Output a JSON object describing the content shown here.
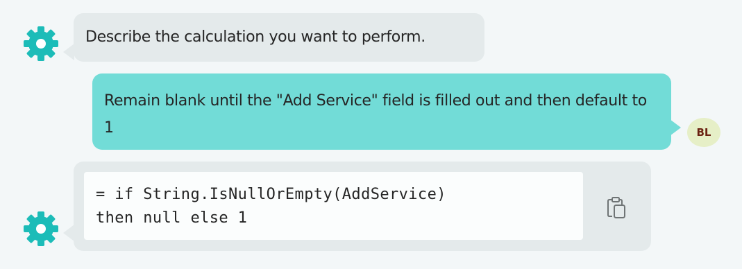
{
  "conversation": {
    "messages": [
      {
        "role": "bot",
        "avatar_icon": "gear-icon",
        "text": "Describe the calculation you want to perform."
      },
      {
        "role": "user",
        "avatar_initials": "BL",
        "text": "Remain blank until the \"Add Service\" field is filled out and then default to 1"
      },
      {
        "role": "bot",
        "avatar_icon": "gear-icon",
        "code_lines": [
          "= if String.IsNullOrEmpty(AddService)",
          "then null else 1"
        ],
        "action_icon": "copy-icon"
      }
    ]
  },
  "colors": {
    "background": "#f3f7f8",
    "bot_bubble": "#e4eaeb",
    "user_bubble": "#72dcd7",
    "bot_icon": "#1cbcb8",
    "user_avatar_bg": "#e6efc7",
    "user_avatar_text": "#6b2212",
    "code_bg": "#fbfdfd"
  }
}
